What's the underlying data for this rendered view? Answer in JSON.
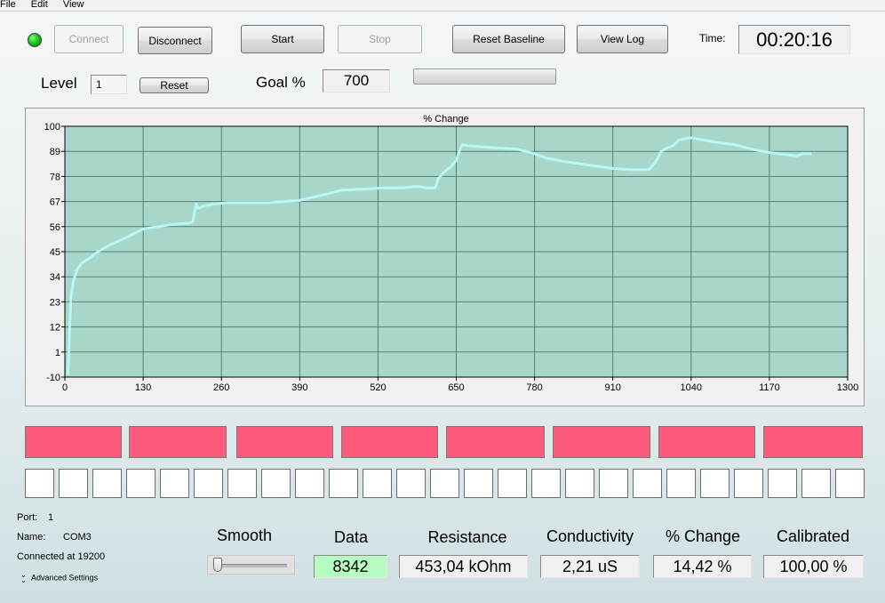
{
  "menu": {
    "items": [
      "File",
      "Edit",
      "View"
    ]
  },
  "toolbar": {
    "connect_label": "Connect",
    "disconnect_label": "Disconnect",
    "start_label": "Start",
    "stop_label": "Stop",
    "reset_baseline_label": "Reset Baseline",
    "view_log_label": "View Log",
    "time_label": "Time:",
    "time_value": "00:20:16",
    "connection_status_color": "#1fc21f"
  },
  "level": {
    "label": "Level",
    "value": "1",
    "reset_label": "Reset",
    "goal_label": "Goal %",
    "goal_value": "700",
    "progress_fraction": 0.0
  },
  "chart_data": {
    "type": "line",
    "title": "% Change",
    "xlabel": "",
    "ylabel": "",
    "xlim": [
      0,
      1300
    ],
    "ylim": [
      -10,
      100
    ],
    "x_ticks": [
      0,
      130,
      260,
      390,
      520,
      650,
      780,
      910,
      1040,
      1170,
      1300
    ],
    "y_ticks": [
      -10,
      1,
      12,
      23,
      34,
      45,
      56,
      67,
      78,
      89,
      100
    ],
    "grid": true,
    "line_color": "#b8f8f4",
    "plot_bg": "#a8d6cb",
    "series": [
      {
        "x": [
          5,
          6,
          8,
          10,
          14,
          20,
          28,
          40,
          55,
          75,
          100,
          130,
          155,
          180,
          205,
          212,
          214,
          216,
          218,
          222,
          230,
          250,
          270,
          300,
          340,
          390,
          430,
          460,
          500,
          530,
          560,
          580,
          590,
          600,
          610,
          615,
          620,
          630,
          640,
          650,
          655,
          660,
          670,
          690,
          720,
          750,
          780,
          800,
          830,
          870,
          910,
          940,
          970,
          980,
          985,
          990,
          1000,
          1010,
          1020,
          1040,
          1060,
          1080,
          1110,
          1140,
          1170,
          1200,
          1215,
          1225,
          1240
        ],
        "values": [
          -9,
          -3,
          12,
          25,
          32,
          37,
          40,
          42,
          45,
          48,
          51,
          55,
          56,
          57,
          57.5,
          58,
          60,
          63,
          66,
          64,
          65,
          66,
          66.5,
          66.5,
          66.5,
          67.5,
          70,
          72,
          72.5,
          73,
          73,
          73.5,
          73.5,
          73,
          73,
          73,
          77,
          80,
          82,
          85,
          89,
          92,
          91.5,
          91,
          90.5,
          90,
          88,
          86,
          84.5,
          83,
          81.5,
          81,
          81,
          84,
          86,
          89,
          90.5,
          91.5,
          94,
          95,
          94,
          93,
          92,
          90,
          88.5,
          87.5,
          87,
          88,
          88
        ]
      }
    ]
  },
  "indicators": {
    "red_segments": [
      "",
      "",
      "",
      "",
      "",
      "",
      "",
      ""
    ],
    "red_color": "#fd5b7b",
    "white_cells": [
      "",
      "",
      "",
      "",
      "",
      "",
      "",
      "",
      "",
      "",
      "",
      "",
      "",
      "",
      "",
      "",
      "",
      "",
      "",
      "",
      "",
      "",
      "",
      "",
      ""
    ]
  },
  "connection_info": {
    "port_label": "Port:",
    "port_value": "1",
    "name_label": "Name:",
    "name_value": "COM3",
    "connected_text": "Connected at 19200",
    "advanced_settings_label": "Advanced Settings"
  },
  "readouts": {
    "smooth_label": "Smooth",
    "smooth_level": 0.0,
    "data_label": "Data",
    "data_value": "8342",
    "data_color": "#b6fcc0",
    "resistance_label": "Resistance",
    "resistance_value": "453,04 kOhm",
    "conductivity_label": "Conductivity",
    "conductivity_value": "2,21 uS",
    "percent_change_label": "% Change",
    "percent_change_value": "14,42 %",
    "calibrated_label": "Calibrated",
    "calibrated_value": "100,00 %"
  }
}
